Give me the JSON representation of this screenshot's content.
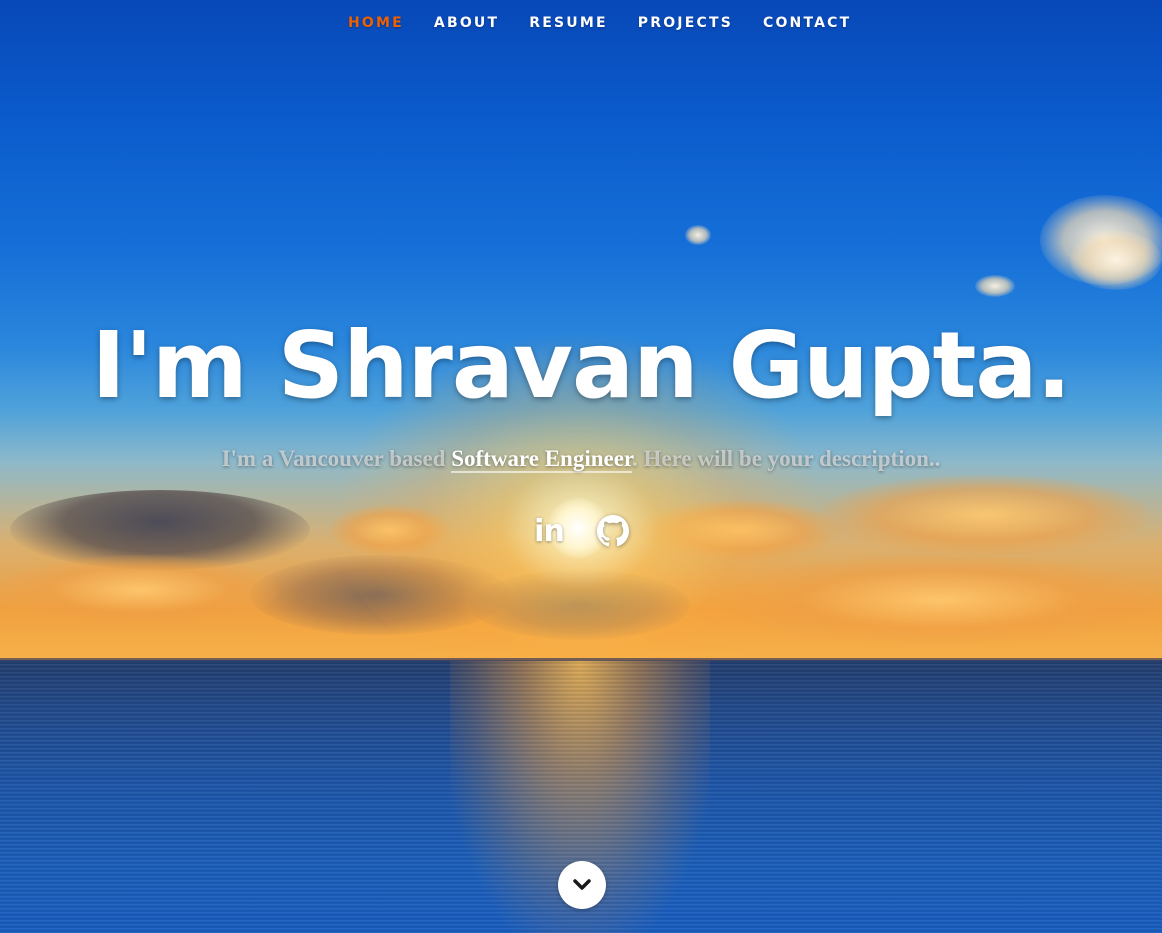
{
  "nav": {
    "items": [
      {
        "label": "HOME",
        "active": true
      },
      {
        "label": "ABOUT",
        "active": false
      },
      {
        "label": "RESUME",
        "active": false
      },
      {
        "label": "PROJECTS",
        "active": false
      },
      {
        "label": "CONTACT",
        "active": false
      }
    ],
    "active_color": "#f06000"
  },
  "banner": {
    "headline": "I'm Shravan Gupta.",
    "tagline_prefix": "I'm a Vancouver based ",
    "tagline_highlight": "Software Engineer",
    "tagline_suffix": ". Here will be your description.."
  },
  "social": {
    "links": [
      {
        "icon": "linkedin-icon",
        "glyph": "in"
      },
      {
        "icon": "github-icon"
      }
    ]
  },
  "scroll_down": {
    "icon": "chevron-down-icon"
  }
}
